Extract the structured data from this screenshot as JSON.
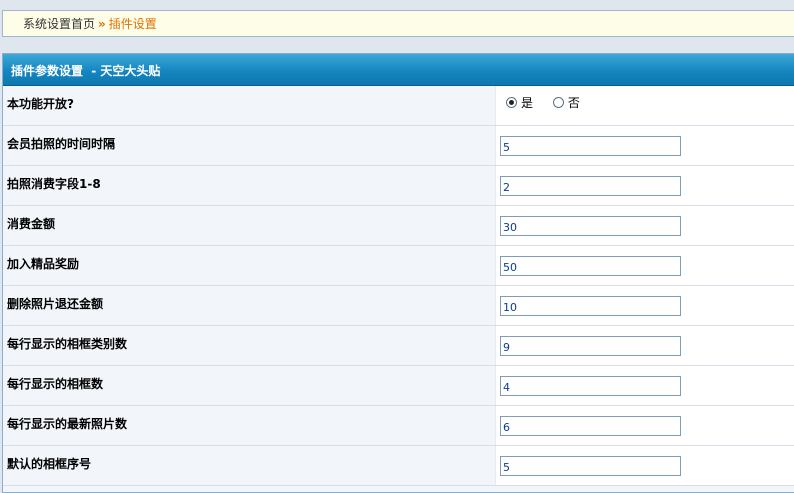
{
  "breadcrumb": {
    "home": "系统设置首页",
    "separator": "»",
    "current": "插件设置"
  },
  "panel": {
    "title": "插件参数设置",
    "subtitle": "- 天空大头贴"
  },
  "settings": [
    {
      "label": "本功能开放?",
      "type": "radio",
      "options": [
        "是",
        "否"
      ],
      "selected": "是"
    },
    {
      "label": "会员拍照的时间时隔",
      "value": "5"
    },
    {
      "label": "拍照消费字段1-8",
      "value": "2"
    },
    {
      "label": "消费金额",
      "value": "30"
    },
    {
      "label": "加入精品奖励",
      "value": "50"
    },
    {
      "label": "删除照片退还金额",
      "value": "10"
    },
    {
      "label": "每行显示的相框类别数",
      "value": "9"
    },
    {
      "label": "每行显示的相框数",
      "value": "4"
    },
    {
      "label": "每行显示的最新照片数",
      "value": "6"
    },
    {
      "label": "默认的相框序号",
      "value": "5"
    }
  ]
}
